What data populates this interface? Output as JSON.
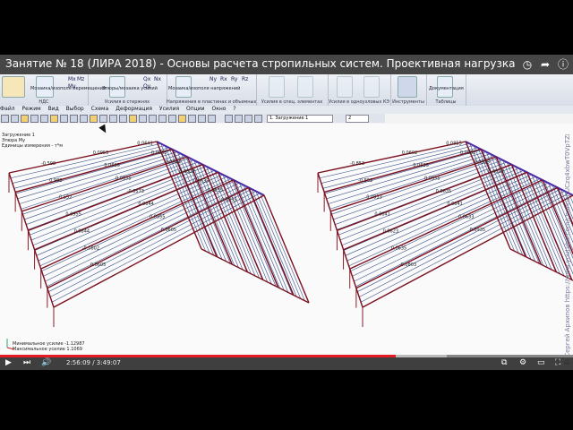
{
  "video_title": "Занятие № 18 (ЛИРА 2018) - Основы расчета стропильных систем. Проективная нагрузка",
  "title_icons": [
    "clock-icon",
    "share-icon",
    "info-icon"
  ],
  "ribbon": {
    "groups": [
      {
        "label": "НДС",
        "btn": "Мозаика/изополя перемещений"
      },
      {
        "label": "Усилия в стержнях",
        "btn": "Эпюры/мозаика усилий"
      },
      {
        "label": "Напряжения в пластинах и объемных КЭ",
        "btn": "Мозаика/изополя напряжений"
      },
      {
        "label": "Усилия в спец. элементах",
        "btn": ""
      },
      {
        "label": "Усилия в одноузловых КЭ",
        "btn": ""
      },
      {
        "label": "Инструменты",
        "btn": ""
      },
      {
        "label": "Таблицы",
        "btn": "Документация"
      }
    ],
    "glyphs": [
      "Mx",
      "My",
      "Mz",
      "Qx",
      "Qy",
      "Nx",
      "Ny",
      "Rx",
      "Ry",
      "Rz"
    ]
  },
  "menu": [
    "Файл",
    "Режим",
    "Вид",
    "Выбор",
    "Схема",
    "Деформация",
    "Усилия",
    "Опции",
    "Окно",
    "?"
  ],
  "loading_combo": "1. Загружение 1",
  "page_combo": "2",
  "info_lines": [
    "Загружение 1",
    "Эпюра My",
    "Единицы измерения - т*м"
  ],
  "legend_lines": [
    "Минимальное усилие -1.12987",
    "Максимальное усилие 1.1069"
  ],
  "player": {
    "time": "2:56:09 / 3:49:07",
    "progress": 0.69,
    "buffered": 0.78
  },
  "credit": "© Сергей Архипов https://www.youtube.com/channel/UCzq4xbwT0VpTZFJX-Zr9RKg",
  "labels_left": [
    "-0.598",
    "0.988",
    "-0.552",
    "0.0955",
    "0.0844",
    "-0.0802",
    "0.0605",
    "0.0955",
    "0.0605",
    "0.0635",
    "-0.0573",
    "0.0644",
    "0.0955",
    "0.0605",
    "0.0641",
    "0.0635",
    "0.0844",
    "0.0802",
    "0.0635",
    "0.0635",
    "0.0955"
  ],
  "labels_right": [
    "-0.853",
    "-0.552",
    "0.0933",
    "0.0841",
    "0.0623",
    "0.0635",
    "-0.0803",
    "0.0602",
    "0.0635",
    "0.0955",
    "0.0635",
    "0.0641",
    "0.0633",
    "0.0935",
    "0.0855",
    "0.0802",
    "0.0935",
    "0.0693"
  ]
}
